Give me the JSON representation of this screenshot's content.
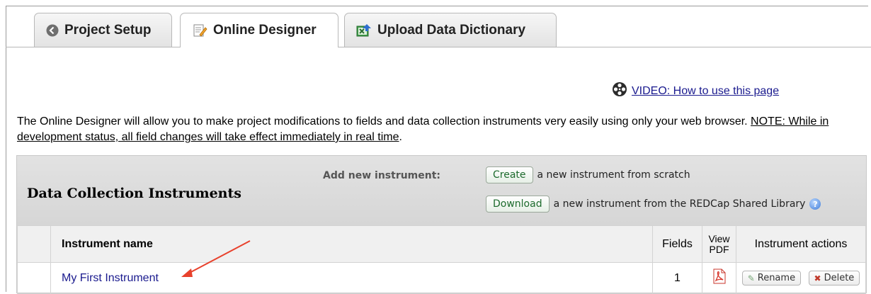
{
  "tabs": [
    {
      "label": "Project Setup",
      "icon": "back-arrow-circle-icon"
    },
    {
      "label": "Online Designer",
      "icon": "designer-edit-icon"
    },
    {
      "label": "Upload Data Dictionary",
      "icon": "excel-upload-icon"
    }
  ],
  "video": {
    "label": "VIDEO: How to use this page",
    "icon": "film-reel-icon"
  },
  "intro": {
    "text": "The Online Designer will allow you to make project modifications to fields and data collection instruments very easily using only your web browser. ",
    "note": "NOTE: While in development status, all field changes will take effect immediately in real time",
    "end": "."
  },
  "panel": {
    "title": "Data Collection Instruments",
    "add_label": "Add new instrument:",
    "create_button": "Create",
    "create_text": "a new instrument from scratch",
    "download_button": "Download",
    "download_text": "a new instrument from the REDCap Shared Library"
  },
  "table": {
    "headers": {
      "name": "Instrument name",
      "fields": "Fields",
      "view_pdf_1": "View",
      "view_pdf_2": "PDF",
      "actions": "Instrument actions"
    },
    "rows": [
      {
        "name": "My First Instrument",
        "fields": "1",
        "rename": "Rename",
        "delete": "Delete"
      }
    ]
  },
  "colors": {
    "link": "#1a1a8e",
    "button_text": "#1d6b2d",
    "header_bg": "#d9d9d9",
    "arrow": "#e8412c"
  }
}
